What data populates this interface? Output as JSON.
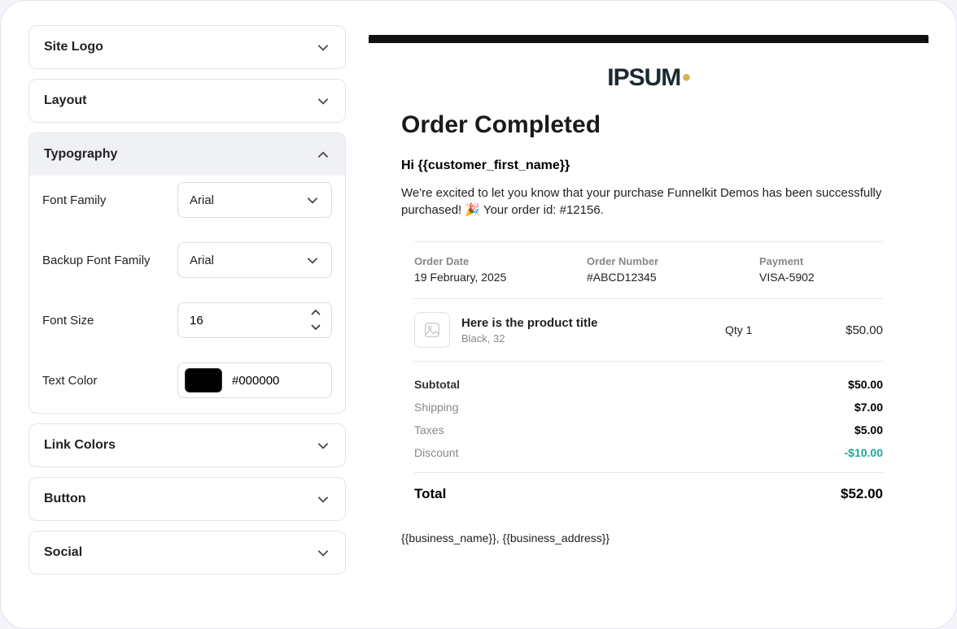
{
  "sidebar": {
    "panels": {
      "site_logo": "Site Logo",
      "layout": "Layout",
      "typography": "Typography",
      "link_colors": "Link Colors",
      "button": "Button",
      "social": "Social"
    },
    "typography": {
      "font_family_label": "Font Family",
      "font_family_value": "Arial",
      "backup_font_label": "Backup Font Family",
      "backup_font_value": "Arial",
      "font_size_label": "Font Size",
      "font_size_value": "16",
      "text_color_label": "Text Color",
      "text_color_value": "#000000"
    }
  },
  "preview": {
    "logo_text": "IPSUM",
    "heading": "Order Completed",
    "greeting": "Hi {{customer_first_name}}",
    "intro": "We're excited to let you know that your purchase Funnelkit Demos has been successfully purchased! 🎉 Your order id: #12156.",
    "meta": {
      "order_date_label": "Order Date",
      "order_date_value": "19 February, 2025",
      "order_number_label": "Order Number",
      "order_number_value": "#ABCD12345",
      "payment_label": "Payment",
      "payment_value": "VISA-5902"
    },
    "product": {
      "title": "Here is the product title",
      "variant": "Black, 32",
      "qty": "Qty 1",
      "price": "$50.00"
    },
    "totals": {
      "subtotal_label": "Subtotal",
      "subtotal_value": "$50.00",
      "shipping_label": "Shipping",
      "shipping_value": "$7.00",
      "taxes_label": "Taxes",
      "taxes_value": "$5.00",
      "discount_label": "Discount",
      "discount_value": "-$10.00",
      "total_label": "Total",
      "total_value": "$52.00"
    },
    "footer": "{{business_name}}, {{business_address}}"
  }
}
